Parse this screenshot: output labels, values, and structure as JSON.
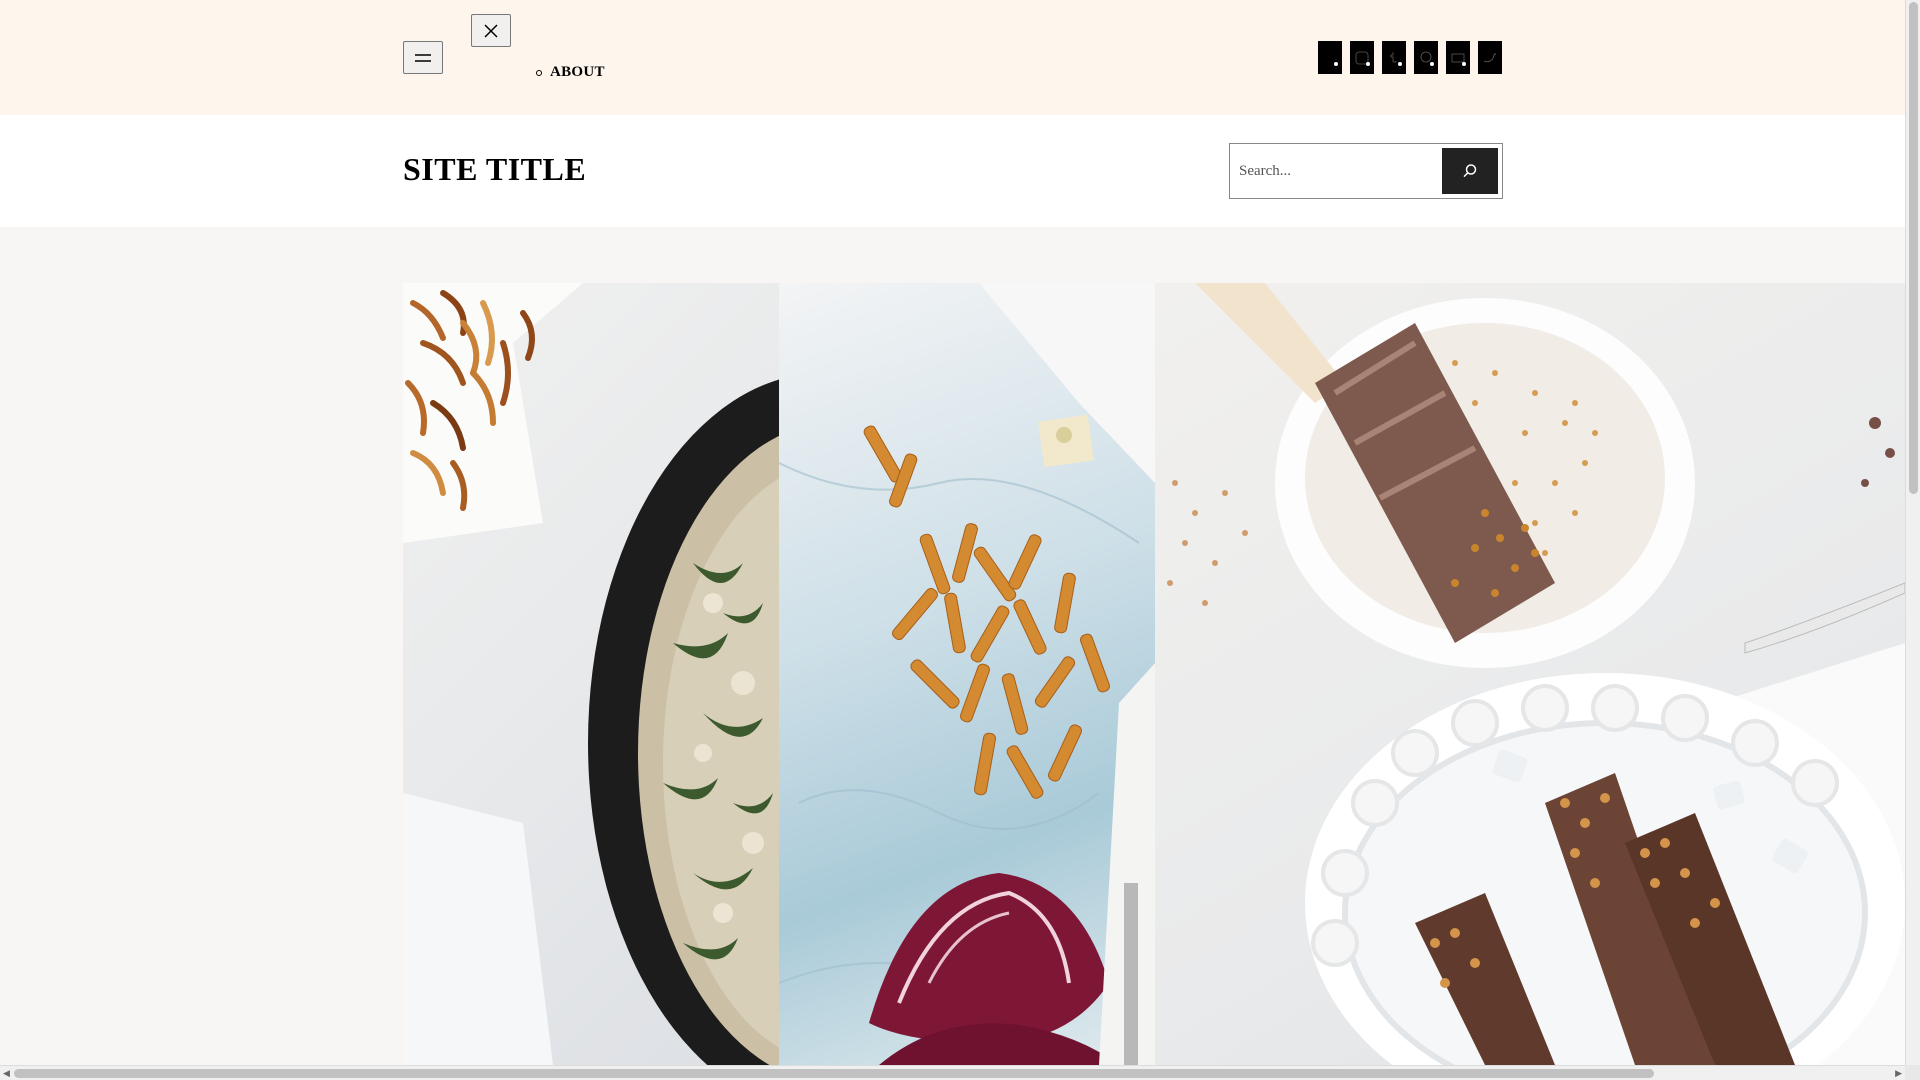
{
  "nav": {
    "items": [
      {
        "label": "ABOUT"
      }
    ]
  },
  "social": [
    {
      "icon": "social-icon-1"
    },
    {
      "icon": "instagram-icon"
    },
    {
      "icon": "tumblr-icon"
    },
    {
      "icon": "pinterest-icon"
    },
    {
      "icon": "mail-icon"
    },
    {
      "icon": "twitter-icon"
    }
  ],
  "header": {
    "site_title": "SITE TITLE"
  },
  "search": {
    "placeholder": "Search..."
  },
  "hero": {
    "panels": [
      {
        "name": "spinach-dip-skillet-image"
      },
      {
        "name": "radicchio-pasta-image"
      },
      {
        "name": "coconut-popsicles-image"
      }
    ]
  },
  "colors": {
    "topbar_bg": "#fef6ec",
    "accent": "#222222"
  }
}
